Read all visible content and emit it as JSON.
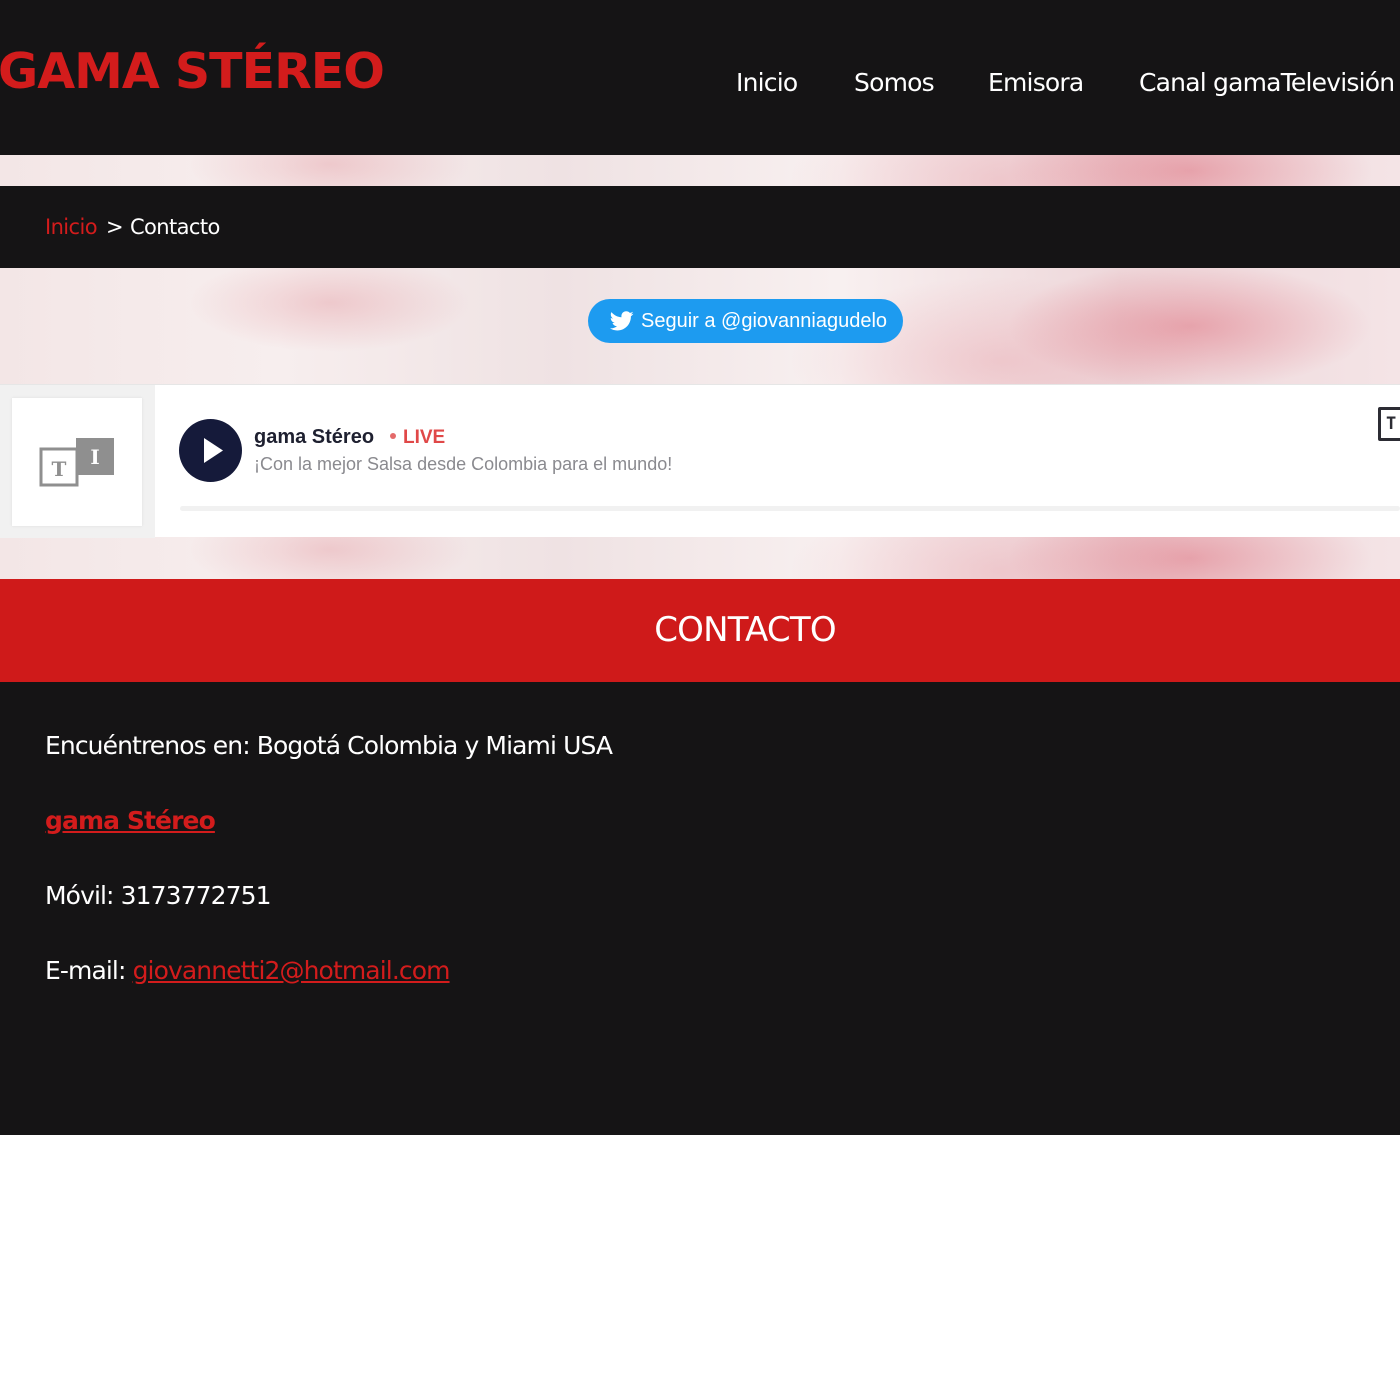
{
  "header": {
    "logo": "GAMA STÉREO",
    "nav": [
      {
        "label": "Inicio"
      },
      {
        "label": "Somos"
      },
      {
        "label": "Emisora"
      },
      {
        "label": "Canal gamaTelevisión"
      }
    ]
  },
  "breadcrumb": {
    "home": "Inicio",
    "separator": ">",
    "current": "Contacto"
  },
  "twitter": {
    "label": "Seguir a @giovanniagudelo",
    "icon": "twitter-bird-icon",
    "color": "#1d9bf0"
  },
  "player": {
    "station": "gama Stéreo",
    "live": "LIVE",
    "tagline": "¡Con la mejor Salsa desde Colombia para el mundo!",
    "corner_icon_letter": "T",
    "art_icon": "text-tiles-icon"
  },
  "contact": {
    "title": "CONTACTO",
    "location_line": "Encuéntrenos en: Bogotá Colombia y Miami USA",
    "brand_link": "gama Stéreo",
    "mobile_line": "Móvil: 3173772751",
    "email_label": "E-mail: ",
    "email": "giovannetti2@hotmail.com"
  },
  "colors": {
    "accent": "#d31c1c",
    "dark": "#151415",
    "player_button": "#151a3a",
    "live": "#e04848"
  }
}
